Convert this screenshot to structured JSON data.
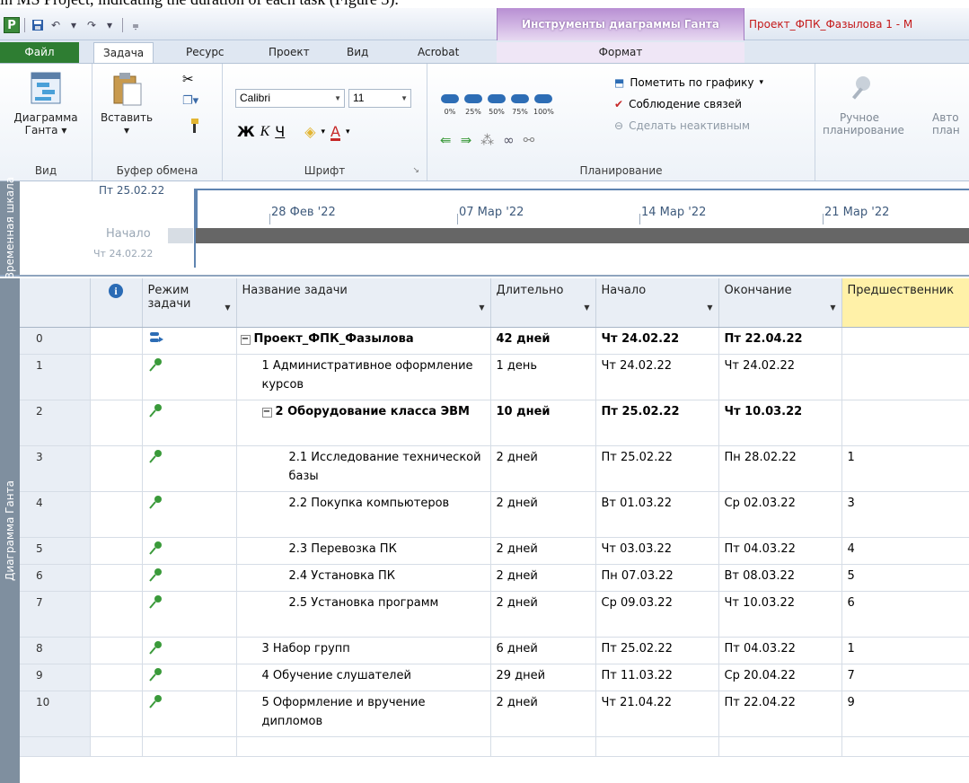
{
  "caption": "in MS Project, indicating the duration of each task (Figure 3).",
  "titlebar": {
    "app_icon_letter": "P",
    "context_tool": "Инструменты диаграммы Ганта",
    "window_title": "Проект_ФПК_Фазылова 1 - M"
  },
  "tabs": [
    "Файл",
    "Задача",
    "Ресурс",
    "Проект",
    "Вид",
    "Acrobat",
    "Формат"
  ],
  "ribbon": {
    "view": {
      "button": "Диаграмма Ганта",
      "group": "Вид"
    },
    "clipboard": {
      "paste": "Вставить",
      "group": "Буфер обмена"
    },
    "font": {
      "family": "Calibri",
      "size": "11",
      "bold": "Ж",
      "italic": "К",
      "underline": "Ч",
      "color_a": "A",
      "group": "Шрифт"
    },
    "scheduling": {
      "pct": [
        "0%",
        "25%",
        "50%",
        "75%",
        "100%"
      ],
      "mark_on_track": "Пометить по графику",
      "respect_links": "Соблюдение связей",
      "inactivate": "Сделать неактивным",
      "group": "Планирование"
    },
    "manual": {
      "label1": "Ручное",
      "label2": "планирование",
      "auto1": "Авто",
      "auto2": "план"
    }
  },
  "timeline": {
    "label": "Временная шкала",
    "today": "Пт 25.02.22",
    "dates": [
      "28 Фев '22",
      "07 Мар '22",
      "14 Мар '22",
      "21 Мар '22"
    ],
    "start_label": "Начало",
    "start_date": "Чт 24.02.22"
  },
  "grid": {
    "side_label": "Диаграмма Ганта",
    "headers": {
      "info": "i",
      "mode": "Режим задачи",
      "name": "Название задачи",
      "duration": "Длительно",
      "start": "Начало",
      "finish": "Окончание",
      "predecessors": "Предшественник"
    },
    "rows": [
      {
        "id": "0",
        "name": "Проект_ФПК_Фазылова",
        "duration": "42 дней",
        "start": "Чт 24.02.22",
        "finish": "Пт 22.04.22",
        "pred": ""
      },
      {
        "id": "1",
        "name": "1 Административное оформление курсов",
        "duration": "1 день",
        "start": "Чт 24.02.22",
        "finish": "Чт 24.02.22",
        "pred": ""
      },
      {
        "id": "2",
        "name": "2 Оборудование класса ЭВМ",
        "duration": "10 дней",
        "start": "Пт 25.02.22",
        "finish": "Чт 10.03.22",
        "pred": ""
      },
      {
        "id": "3",
        "name": "2.1 Исследование технической базы",
        "duration": "2 дней",
        "start": "Пт 25.02.22",
        "finish": "Пн 28.02.22",
        "pred": "1"
      },
      {
        "id": "4",
        "name": "2.2 Покупка компьютеров",
        "duration": "2 дней",
        "start": "Вт 01.03.22",
        "finish": "Ср 02.03.22",
        "pred": "3"
      },
      {
        "id": "5",
        "name": "2.3 Перевозка ПК",
        "duration": "2 дней",
        "start": "Чт 03.03.22",
        "finish": "Пт 04.03.22",
        "pred": "4"
      },
      {
        "id": "6",
        "name": "2.4 Установка ПК",
        "duration": "2 дней",
        "start": "Пн 07.03.22",
        "finish": "Вт 08.03.22",
        "pred": "5"
      },
      {
        "id": "7",
        "name": "2.5 Установка программ",
        "duration": "2 дней",
        "start": "Ср 09.03.22",
        "finish": "Чт 10.03.22",
        "pred": "6"
      },
      {
        "id": "8",
        "name": "3 Набор групп",
        "duration": "6 дней",
        "start": "Пт 25.02.22",
        "finish": "Пт 04.03.22",
        "pred": "1"
      },
      {
        "id": "9",
        "name": "4 Обучение слушателей",
        "duration": "29 дней",
        "start": "Пт 11.03.22",
        "finish": "Ср 20.04.22",
        "pred": "7"
      },
      {
        "id": "10",
        "name": "5 Оформление и вручение дипломов",
        "duration": "2 дней",
        "start": "Чт 21.04.22",
        "finish": "Пт 22.04.22",
        "pred": "9"
      }
    ]
  },
  "colors": {
    "accent": "#2d6db5",
    "file_tab": "#2e7d32",
    "context_tab": "#b88fd3",
    "pred_header": "#fff1a8"
  }
}
